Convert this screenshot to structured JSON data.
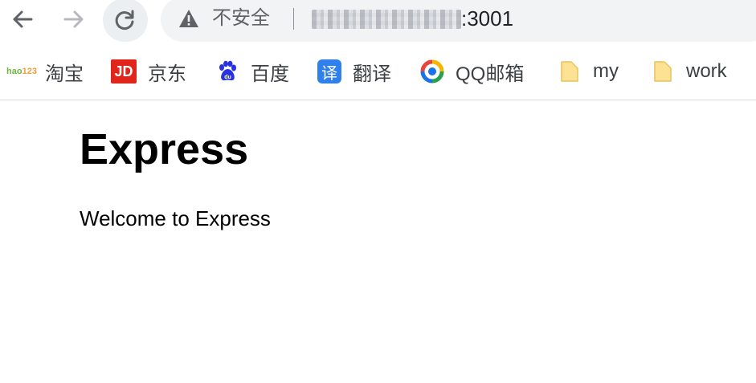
{
  "toolbar": {
    "back_icon": "arrow-left-icon",
    "forward_icon": "arrow-right-icon",
    "reload_icon": "reload-icon"
  },
  "omnibox": {
    "security_icon": "warning-triangle-icon",
    "security_label": "不安全",
    "url_host_redacted": true,
    "url_port": ":3001"
  },
  "bookmarks": [
    {
      "label": "淘宝",
      "icon": "hao123-icon"
    },
    {
      "label": "京东",
      "icon": "jd-icon"
    },
    {
      "label": "百度",
      "icon": "baidu-paw-icon"
    },
    {
      "label": "翻译",
      "icon": "translate-icon"
    },
    {
      "label": "QQ邮箱",
      "icon": "qq-mail-icon"
    },
    {
      "label": "my",
      "icon": "folder-icon"
    },
    {
      "label": "work",
      "icon": "folder-icon"
    }
  ],
  "page": {
    "title": "Express",
    "text": "Welcome to Express"
  },
  "colors": {
    "jd_red": "#e1251b",
    "translate_blue": "#2f80ed",
    "folder_yellow": "#fde293",
    "baidu_blue": "#2932e1"
  },
  "icon_glyphs": {
    "hao_top": "hao",
    "hao_bottom": "123",
    "jd": "JD",
    "translate": "译"
  }
}
